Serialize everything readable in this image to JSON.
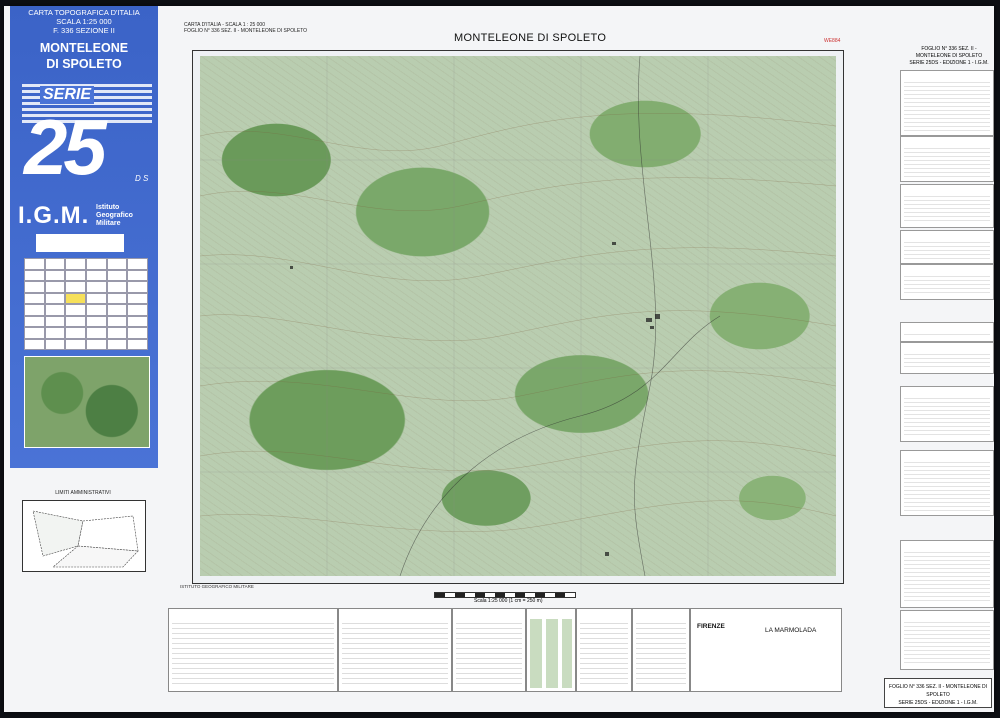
{
  "cover": {
    "line1": "CARTA TOPOGRAFICA D'ITALIA",
    "line2": "SCALA 1:25 000",
    "line3": "F. 336 SEZIONE II",
    "title1": "MONTELEONE",
    "title2": "DI SPOLETO",
    "serie": "SERIE",
    "number": "25",
    "ds": "D S",
    "igm": "I.G.M.",
    "igm_sub1": "Istituto",
    "igm_sub2": "Geografico",
    "igm_sub3": "Militare"
  },
  "map": {
    "header_line1": "CARTA D'ITALIA  -  SCALA 1 : 25 000",
    "header_line2": "FOGLIO N° 336 SEZ. II - MONTELEONE DI SPOLETO",
    "title": "MONTELEONE DI SPOLETO",
    "corner_label": "WE884",
    "publisher": "ISTITUTO GEOGRAFICO MILITARE",
    "admin_title": "LIMITI AMMINISTRATIVI",
    "scale_text": "Scala 1:25 000 (1 cm = 250 m)"
  },
  "legend_places": [
    "FIRENZE",
    "LA MARMOLADA"
  ],
  "folio": {
    "top_line1": "FOGLIO N° 336 SEZ. II - MONTELEONE DI SPOLETO",
    "top_line2": "SERIE 25DS - EDIZIONE 1 - I.G.M.",
    "bottom_line1": "FOGLIO N° 336 SEZ. II - MONTELEONE DI SPOLETO",
    "bottom_line2": "SERIE 25DS - EDIZIONE 1 - I.G.M."
  }
}
